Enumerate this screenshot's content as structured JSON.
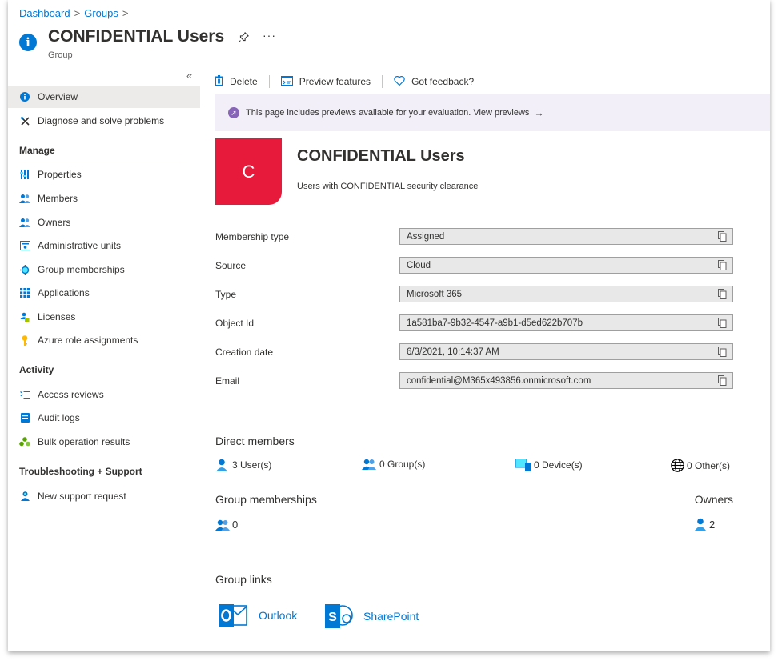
{
  "breadcrumb": {
    "items": [
      "Dashboard",
      "Groups"
    ]
  },
  "header": {
    "title": "CONFIDENTIAL Users",
    "subtitle": "Group"
  },
  "sidebar": {
    "items": [
      {
        "label": "Overview",
        "icon": "info-icon",
        "active": true
      },
      {
        "label": "Diagnose and solve problems",
        "icon": "wrench-icon"
      }
    ],
    "manage_label": "Manage",
    "manage": [
      {
        "label": "Properties",
        "icon": "properties-icon"
      },
      {
        "label": "Members",
        "icon": "members-icon"
      },
      {
        "label": "Owners",
        "icon": "owners-icon"
      },
      {
        "label": "Administrative units",
        "icon": "admin-units-icon"
      },
      {
        "label": "Group memberships",
        "icon": "group-memberships-icon"
      },
      {
        "label": "Applications",
        "icon": "applications-icon"
      },
      {
        "label": "Licenses",
        "icon": "licenses-icon"
      },
      {
        "label": "Azure role assignments",
        "icon": "key-icon"
      }
    ],
    "activity_label": "Activity",
    "activity": [
      {
        "label": "Access reviews",
        "icon": "access-reviews-icon"
      },
      {
        "label": "Audit logs",
        "icon": "audit-logs-icon"
      },
      {
        "label": "Bulk operation results",
        "icon": "bulk-operation-icon"
      }
    ],
    "support_label": "Troubleshooting + Support",
    "support": [
      {
        "label": "New support request",
        "icon": "support-request-icon"
      }
    ]
  },
  "toolbar": {
    "delete_label": "Delete",
    "preview_label": "Preview features",
    "feedback_label": "Got feedback?"
  },
  "banner": {
    "text": "This page includes previews available for your evaluation. View previews"
  },
  "group": {
    "initial": "C",
    "name": "CONFIDENTIAL Users",
    "description": "Users with CONFIDENTIAL security clearance"
  },
  "properties": [
    {
      "label": "Membership type",
      "value": "Assigned"
    },
    {
      "label": "Source",
      "value": "Cloud"
    },
    {
      "label": "Type",
      "value": "Microsoft 365"
    },
    {
      "label": "Object Id",
      "value": "1a581ba7-9b32-4547-a9b1-d5ed622b707b"
    },
    {
      "label": "Creation date",
      "value": "6/3/2021, 10:14:37 AM"
    },
    {
      "label": "Email",
      "value": "confidential@M365x493856.onmicrosoft.com"
    }
  ],
  "direct_members": {
    "heading": "Direct members",
    "users": "3 User(s)",
    "groups": "0 Group(s)",
    "devices": "0 Device(s)",
    "others": "0 Other(s)"
  },
  "group_memberships": {
    "heading": "Group memberships",
    "count": "0"
  },
  "owners": {
    "heading": "Owners",
    "count": "2"
  },
  "group_links": {
    "heading": "Group links",
    "outlook": "Outlook",
    "sharepoint": "SharePoint"
  },
  "colors": {
    "accent": "#0078d4",
    "avatar": "#e81a3b",
    "banner_bg": "#f3eff8",
    "banner_icon": "#8764b8"
  }
}
